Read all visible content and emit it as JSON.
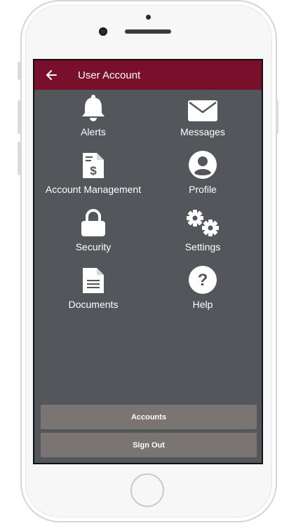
{
  "appbar": {
    "title": "User Account"
  },
  "menu": {
    "items": [
      {
        "label": "Alerts",
        "icon": "bell-icon"
      },
      {
        "label": "Messages",
        "icon": "envelope-icon"
      },
      {
        "label": "Account Management",
        "icon": "invoice-icon"
      },
      {
        "label": "Profile",
        "icon": "user-circle-icon"
      },
      {
        "label": "Security",
        "icon": "lock-icon"
      },
      {
        "label": "Settings",
        "icon": "gears-icon"
      },
      {
        "label": "Documents",
        "icon": "document-icon"
      },
      {
        "label": "Help",
        "icon": "question-circle-icon"
      }
    ]
  },
  "buttons": {
    "accounts": "Accounts",
    "sign_out": "Sign Out"
  },
  "colors": {
    "header": "#7a0f2b",
    "background": "#53565b",
    "button": "#7a7472"
  }
}
